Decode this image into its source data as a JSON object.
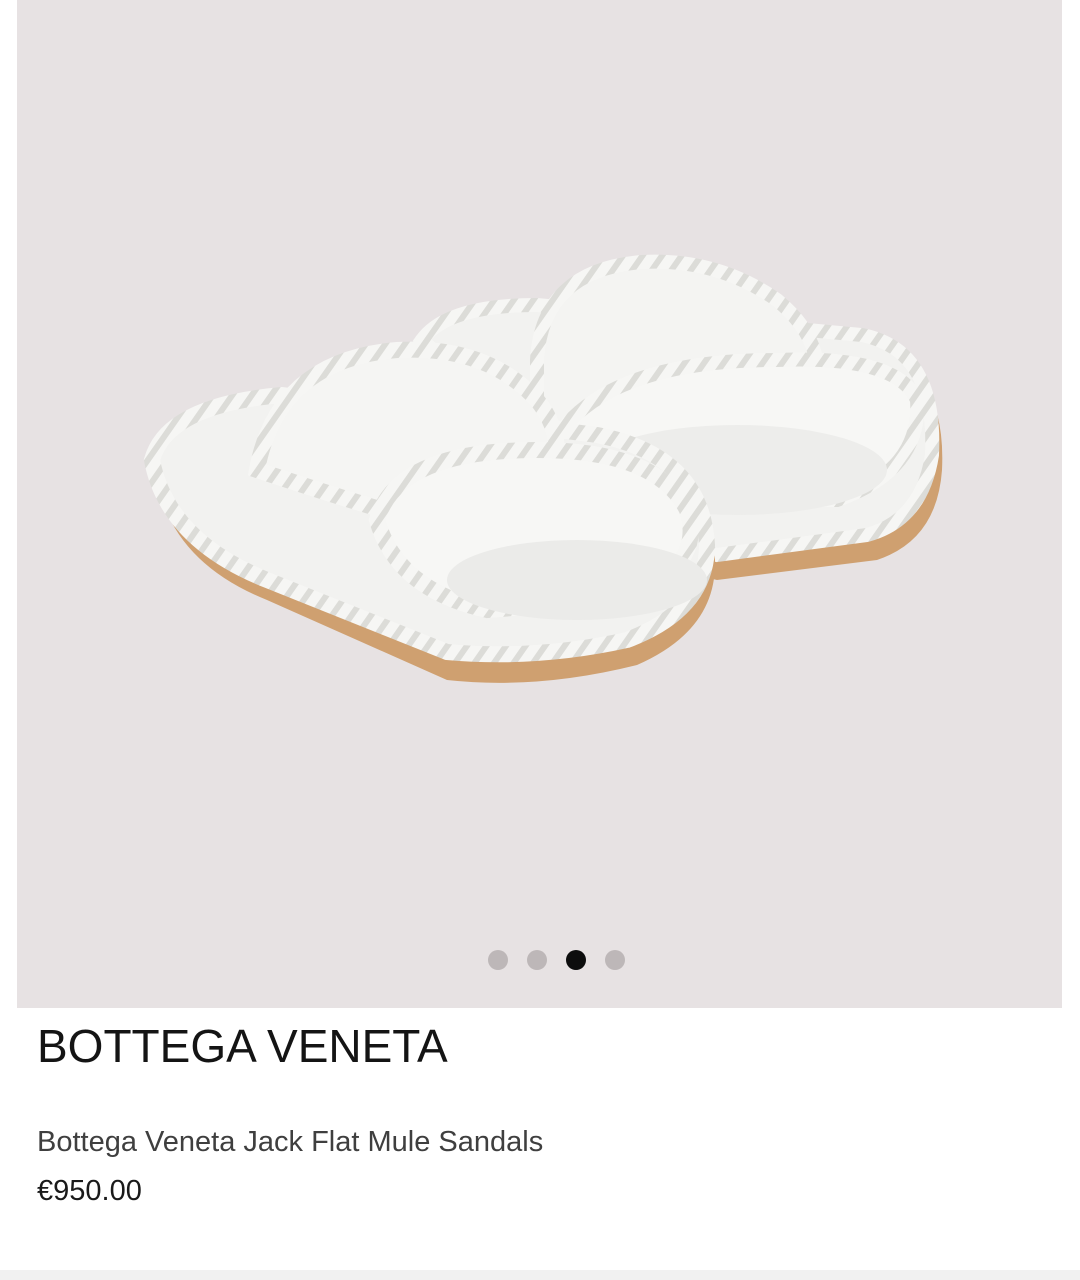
{
  "gallery": {
    "image_name": "white-rope-trim-slide-sandals",
    "dots": [
      {
        "label": "image-1",
        "active": false
      },
      {
        "label": "image-2",
        "active": false
      },
      {
        "label": "image-3",
        "active": true
      },
      {
        "label": "image-4",
        "active": false
      }
    ],
    "background_color": "#e7e2e3",
    "active_dot_color": "#0d0d0d",
    "inactive_dot_color": "#bdb7b8"
  },
  "product": {
    "brand": "BOTTEGA VENETA",
    "name": "Bottega Veneta Jack Flat Mule Sandals",
    "price": "€950.00"
  }
}
